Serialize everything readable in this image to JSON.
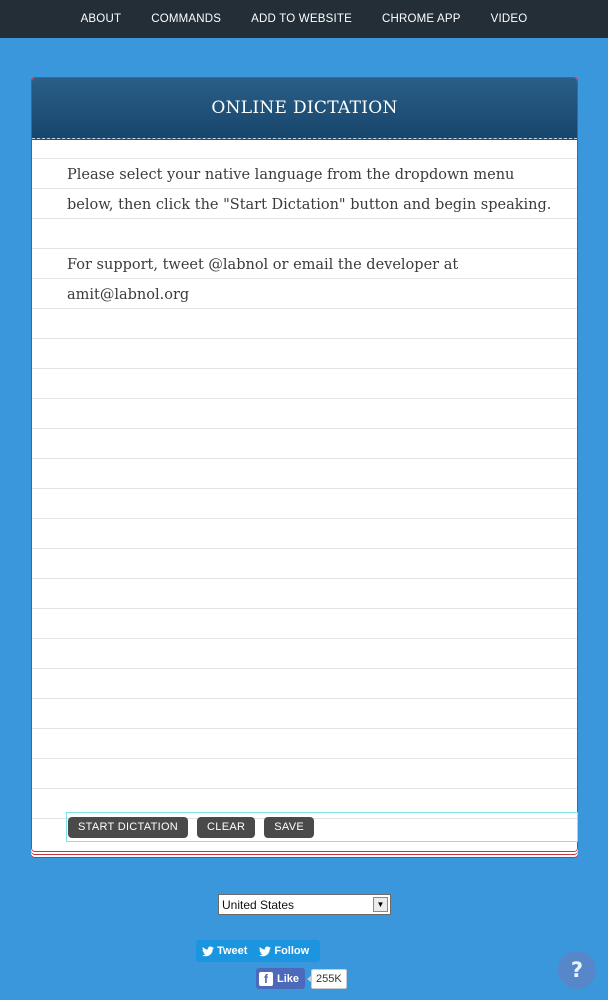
{
  "nav": {
    "items": [
      {
        "label": "ABOUT"
      },
      {
        "label": "COMMANDS"
      },
      {
        "label": "ADD TO WEBSITE"
      },
      {
        "label": "CHROME APP"
      },
      {
        "label": "VIDEO"
      }
    ]
  },
  "card": {
    "title": "ONLINE DICTATION",
    "instructions": "Please select your native language from the dropdown menu below, then click the \"Start Dictation\" button and begin speaking.",
    "support": "For support, tweet @labnol or email the developer at amit@labnol.org"
  },
  "toolbar": {
    "start_label": "START DICTATION",
    "clear_label": "CLEAR",
    "save_label": "SAVE"
  },
  "language": {
    "selected": "United States",
    "arrow_icon": "dropdown-arrow-icon"
  },
  "social": {
    "tweet_label": "Tweet",
    "follow_label": "Follow",
    "like_label": "Like",
    "like_count": "255K",
    "twitter_color": "#1b95e0",
    "facebook_color": "#4c69ba"
  },
  "help": {
    "label": "?"
  },
  "colors": {
    "background": "#3a97dc",
    "nav_bg": "#232e36",
    "header_bg": "#1f4d74",
    "card_border": "#c9313f",
    "button_bg": "#4a4a4a"
  }
}
